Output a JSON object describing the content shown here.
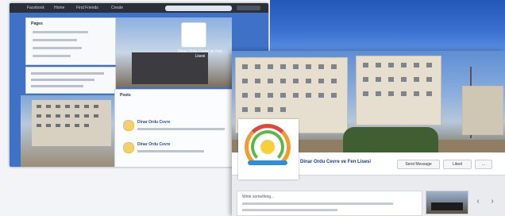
{
  "left_window": {
    "topbar": {
      "items": [
        "Facebook",
        "Home",
        "Find Friends",
        "Create"
      ]
    },
    "sidebar_title": "Pages",
    "panel_heading": "Posts",
    "cover_page_name": "Dinar Ordu Cevre ve Fen Lisesi",
    "posts": [
      {
        "author": "Dinar Ordu Cevre"
      },
      {
        "author": "Dinar Ordu Cevre"
      }
    ]
  },
  "front_page": {
    "page_name": "Dinar Ordu Cevre ve Fen Lisesi",
    "buttons": {
      "message": "Send Message",
      "like": "Liked",
      "more": "..."
    },
    "composer_label": "Write something...",
    "nav_prev": "‹",
    "nav_next": "›"
  },
  "colors": {
    "fb_blue": "#3f72c6",
    "logo_red": "#e24638",
    "logo_orange": "#f39b2e",
    "logo_green": "#5bb848",
    "logo_sun": "#f7cf3a",
    "logo_water": "#2e8fd6"
  },
  "icons": [
    "facebook-logo",
    "search-icon",
    "chevron-left-icon",
    "chevron-right-icon"
  ]
}
